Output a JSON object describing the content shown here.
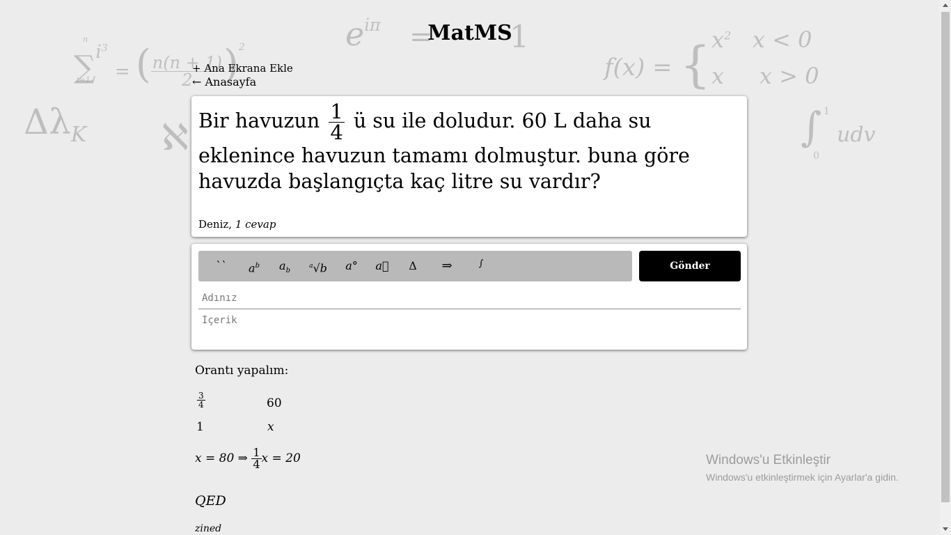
{
  "header": {
    "title": "MatMS",
    "add_home": "+ Ana Ekrana Ekle",
    "back": "←  Anasayfa"
  },
  "background_math": {
    "sum": "∑ i³ = ( n(n+1)/2 )²",
    "sum_top": "n",
    "sum_bottom": "i=1",
    "euler": "e^iπ = 1",
    "piecewise_lhs": "f(x) = {",
    "piecewise_row1": "x²   x < 0",
    "piecewise_row2": "x    x > 0",
    "delta_lambda": "Δλ",
    "delta_sub": "K",
    "aleph": "ℵ",
    "integral": "∫",
    "integral_body": "udv",
    "integral_upper": "1",
    "integral_lower": "0"
  },
  "question": {
    "text_before": "Bir havuzun",
    "frac_num": "1",
    "frac_den": "4",
    "text_after": " ü su ile doludur. 60 L daha su eklenince havuzun tamamı dolmuştur. buna göre havuzda başlangıçta kaç litre su vardır?",
    "author": "Deniz, ",
    "answer_count": "1 cevap"
  },
  "toolbar": {
    "buttons": [
      {
        "label": "``",
        "name": "code-button"
      },
      {
        "label": "aᵇ",
        "name": "superscript-button"
      },
      {
        "label": "a_b",
        "name": "subscript-button"
      },
      {
        "label": "ᵃ√b",
        "name": "root-button"
      },
      {
        "label": "a°",
        "name": "degree-button"
      },
      {
        "label": "a⃗",
        "name": "vector-button"
      },
      {
        "label": "Δ",
        "name": "delta-button"
      },
      {
        "label": "⇒",
        "name": "implies-button"
      },
      {
        "label": "∫",
        "name": "integral-button"
      }
    ],
    "send_label": "Gönder"
  },
  "form": {
    "name_placeholder": "Adınız",
    "content_placeholder": "İçerik"
  },
  "answer": {
    "intro": "Orantı yapalım:",
    "row1_left_num": "3",
    "row1_left_den": "4",
    "row1_right": "60",
    "row2_left": "1",
    "row2_right": "x",
    "eq_part1": "x = 80 ⇒ ",
    "eq_frac_num": "1",
    "eq_frac_den": "4",
    "eq_part2": "x = 20",
    "qed": "QED",
    "author": "zined"
  },
  "watermark": {
    "title": "Windows'u Etkinleştir",
    "subtitle": "Windows'u etkinleştirmek için Ayarlar'a gidin."
  }
}
